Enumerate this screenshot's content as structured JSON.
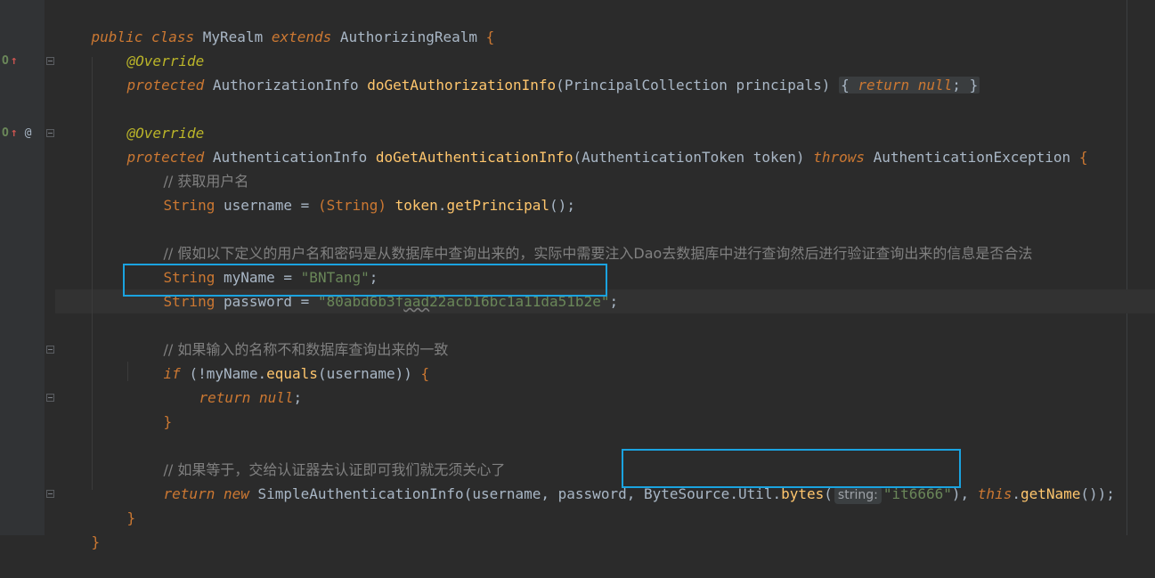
{
  "colors": {
    "background": "#2b2b2b",
    "gutter": "#313335",
    "keyword": "#cc7832",
    "string": "#6a8759",
    "comment": "#808080",
    "annotation": "#bbb529",
    "method": "#ffc66d",
    "plain": "#a9b7c6",
    "highlight_box": "#1aa3e0"
  },
  "gutter_icons": {
    "override_marker": "override-icon",
    "arrow_up": "implements-arrow-icon",
    "at": "@"
  },
  "code": {
    "l1": {
      "kw1": "public class ",
      "name": "MyRealm ",
      "kw2": "extends ",
      "parent": "AuthorizingRealm ",
      "brace": "{"
    },
    "l2": {
      "ann": "@Override"
    },
    "l3": {
      "kw": "protected ",
      "type": "AuthorizationInfo ",
      "fn": "doGetAuthorizationInfo",
      "open": "(",
      "ptype": "PrincipalCollection ",
      "pname": "principals",
      "close": ") ",
      "b1": "{",
      "ret": " return ",
      "nul": "null",
      "semi": "; ",
      "b2": "}"
    },
    "l5": {
      "ann": "@Override"
    },
    "l6": {
      "kw": "protected ",
      "type": "AuthenticationInfo ",
      "fn": "doGetAuthenticationInfo",
      "open": "(",
      "ptype": "AuthenticationToken ",
      "pname": "token",
      "close": ") ",
      "throws": "throws ",
      "exc": "AuthenticationException ",
      "brace": "{"
    },
    "l7": {
      "cmt": "// 获取用户名"
    },
    "l8": {
      "type": "String ",
      "var": "username = ",
      "cast": "(String) ",
      "tok": "token",
      "dot": ".",
      "call": "getPrincipal",
      "rest": "();"
    },
    "l10": {
      "cmt": "// 假如以下定义的用户名和密码是从数据库中查询出来的，实际中需要注入Dao去数据库中进行查询然后进行验证查询出来的信息是否合法"
    },
    "l11": {
      "type": "String ",
      "var": "myName = ",
      "val": "\"BNTang\"",
      "semi": ";"
    },
    "l12": {
      "type": "String ",
      "var": "password = ",
      "val1": "\"80abd6b3f",
      "val2": "aad",
      "val3": "22acb16bc1a11da51b2e\"",
      "semi": ";"
    },
    "l14": {
      "cmt": "// 如果输入的名称不和数据库查询出来的一致"
    },
    "l15": {
      "kw": "if ",
      "open": "(!myName.",
      "call": "equals",
      "rest": "(username)) ",
      "brace": "{"
    },
    "l16": {
      "kw": "return ",
      "nul": "null",
      "semi": ";"
    },
    "l17": {
      "brace": "}"
    },
    "l19": {
      "cmt": "// 如果等于，交给认证器去认证即可我们就无须关心了"
    },
    "l20": {
      "kw": "return new ",
      "cls": "SimpleAuthenticationInfo",
      "args": "(username, password, ",
      "bs": "ByteSource.Util.",
      "bytes": "bytes",
      "open": "(",
      "hint": "string:",
      "val": "\"it6666\"",
      "close": ")",
      "comma": ", ",
      "this": "this",
      "dot": ".",
      "getname": "getName",
      "end": "());"
    },
    "l21": {
      "brace": "}"
    },
    "l22": {
      "brace": "}"
    }
  }
}
